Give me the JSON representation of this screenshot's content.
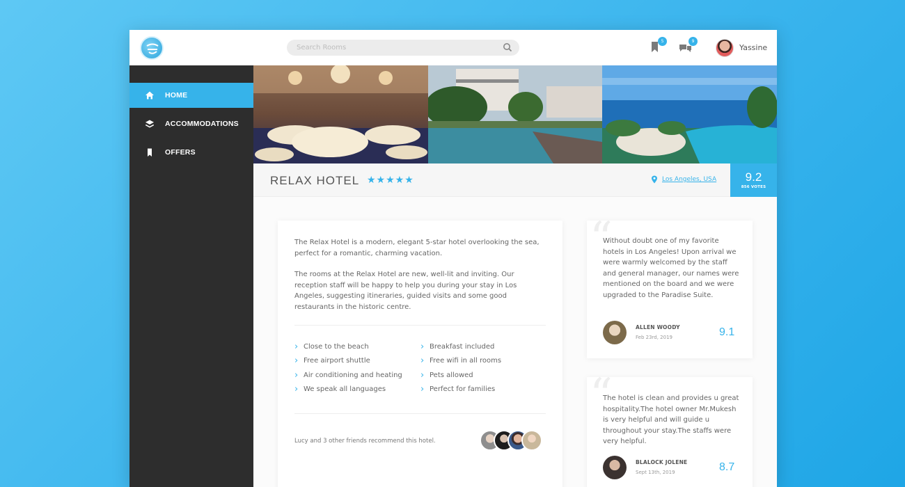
{
  "header": {
    "search_placeholder": "Search Rooms",
    "bookmarks_badge": "5",
    "messages_badge": "9",
    "username": "Yassine"
  },
  "sidebar": {
    "items": [
      {
        "label": "HOME",
        "icon": "home-icon",
        "active": true
      },
      {
        "label": "ACCOMMODATIONS",
        "icon": "layers-icon",
        "active": false
      },
      {
        "label": "OFFERS",
        "icon": "bookmark-icon",
        "active": false
      }
    ]
  },
  "hotel": {
    "name": "RELAX HOTEL",
    "stars": "★★★★★",
    "location": "Los Angeles, USA",
    "score": "9.2",
    "votes": "856 VOTES",
    "description": [
      "The Relax Hotel is a modern, elegant 5-star hotel overlooking the sea, perfect for a romantic, charming vacation.",
      "The rooms at the Relax Hotel are new, well-lit and inviting. Our reception staff will be happy to help you during your stay in Los Angeles, suggesting itineraries, guided visits and some good restaurants in the historic centre."
    ],
    "features": [
      "Close to the beach",
      "Breakfast included",
      "Free airport shuttle",
      "Free wifi in all rooms",
      "Air conditioning and heating",
      "Pets allowed",
      "We speak all languages",
      "Perfect for families"
    ],
    "recommend_text": "Lucy and 3 other friends recommend this hotel."
  },
  "reviews": [
    {
      "text": "Without doubt one of my favorite hotels in Los Angeles! Upon arrival we were warmly welcomed by the staff and general manager, our names were mentioned on the board and we were upgraded to the Paradise Suite.",
      "name": "ALLEN WOODY",
      "date": "Feb 23rd, 2019",
      "score": "9.1"
    },
    {
      "text": "The hotel is clean and provides u great hospitality.The hotel owner Mr.Mukesh is very helpful and will guide u throughout your stay.The staffs were very helpful.",
      "name": "BLALOCK JOLENE",
      "date": "Sept 13th, 2019",
      "score": "8.7"
    }
  ],
  "colors": {
    "accent": "#36b3ea",
    "sidebar": "#2d2d2d"
  }
}
